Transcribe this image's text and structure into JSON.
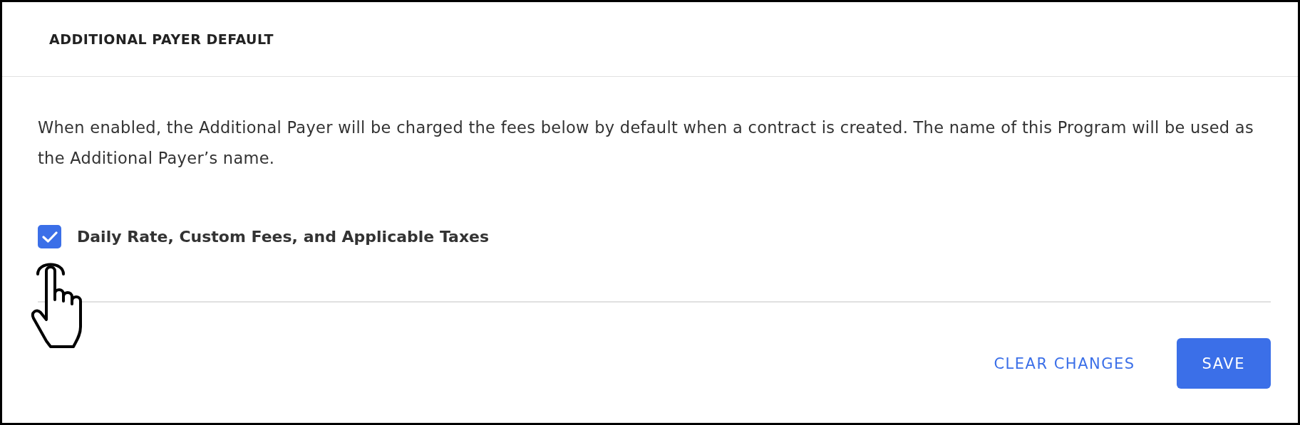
{
  "panel": {
    "title": "ADDITIONAL PAYER DEFAULT"
  },
  "description": "When enabled, the Additional Payer will be charged the fees below by default when a contract is created. The name of this Program will be used as the Additional Payer’s name.",
  "options": [
    {
      "label": "Daily Rate, Custom Fees, and Applicable Taxes",
      "checked": true
    }
  ],
  "buttons": [
    {
      "label": "CLEAR CHANGES",
      "kind": "text"
    },
    {
      "label": "SAVE",
      "kind": "primary"
    }
  ]
}
